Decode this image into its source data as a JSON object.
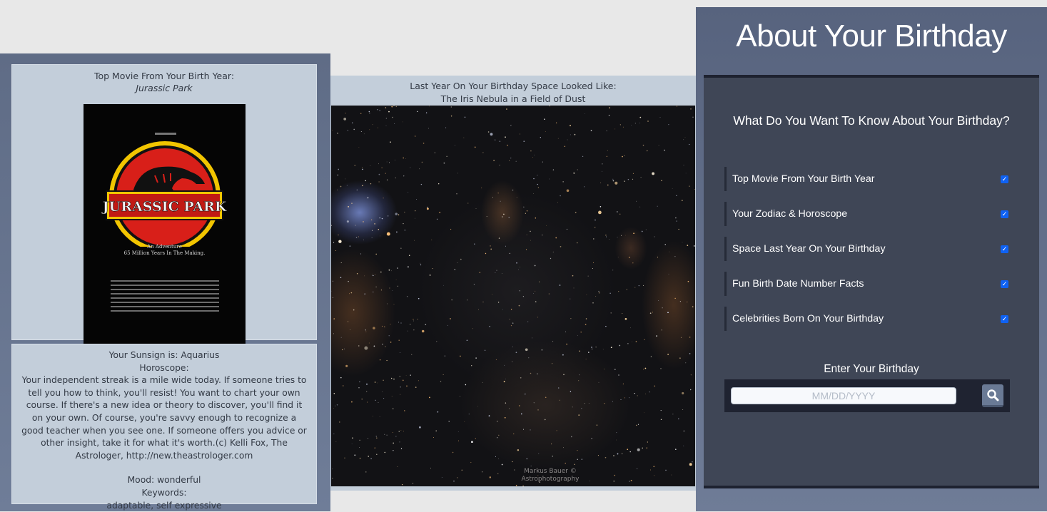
{
  "movie": {
    "heading": "Top Movie From Your Birth Year:",
    "title": "Jurassic Park",
    "poster": {
      "logo_text": "JURASSIC PARK",
      "tagline_line1": "An Adventure",
      "tagline_line2": "65 Million Years In The Making."
    }
  },
  "horoscope": {
    "sunsign": "Your Sunsign is: Aquarius",
    "label": "Horoscope:",
    "text": "Your independent streak is a mile wide today. If someone tries to tell you how to think, you'll resist! You want to chart your own course. If there's a new idea or theory to discover, you'll find it on your own. Of course, you're savvy enough to recognize a good teacher when you see one. If someone offers you advice or other insight, take it for what it's worth.(c) Kelli Fox, The Astrologer, http://new.theastrologer.com",
    "mood": "Mood: wonderful",
    "keywords_label": "Keywords:",
    "keywords": "adaptable, self expressive"
  },
  "space": {
    "heading": "Last Year On Your Birthday Space Looked Like:",
    "image_title": "The Iris Nebula in a Field of Dust",
    "credit_line1": "Markus Bauer ©",
    "credit_line2": "Astrophotography"
  },
  "sidebar": {
    "title": "About Your Birthday",
    "question": "What Do You Want To Know About Your Birthday?",
    "options": [
      {
        "label": "Top Movie From Your Birth Year",
        "checked": true
      },
      {
        "label": "Your Zodiac & Horoscope",
        "checked": true
      },
      {
        "label": "Space Last Year On Your Birthday",
        "checked": true
      },
      {
        "label": "Fun Birth Date Number Facts",
        "checked": true
      },
      {
        "label": "Celebrities Born On Your Birthday",
        "checked": true
      }
    ],
    "enter_label": "Enter Your Birthday",
    "date_placeholder": "MM/DD/YYYY",
    "search_icon": "search-icon"
  },
  "colors": {
    "card_bg": "#c3ceda",
    "form_bg": "#3f4656",
    "checkbox_blue": "#0f62f3",
    "panel_slate": "#5f6c86"
  }
}
